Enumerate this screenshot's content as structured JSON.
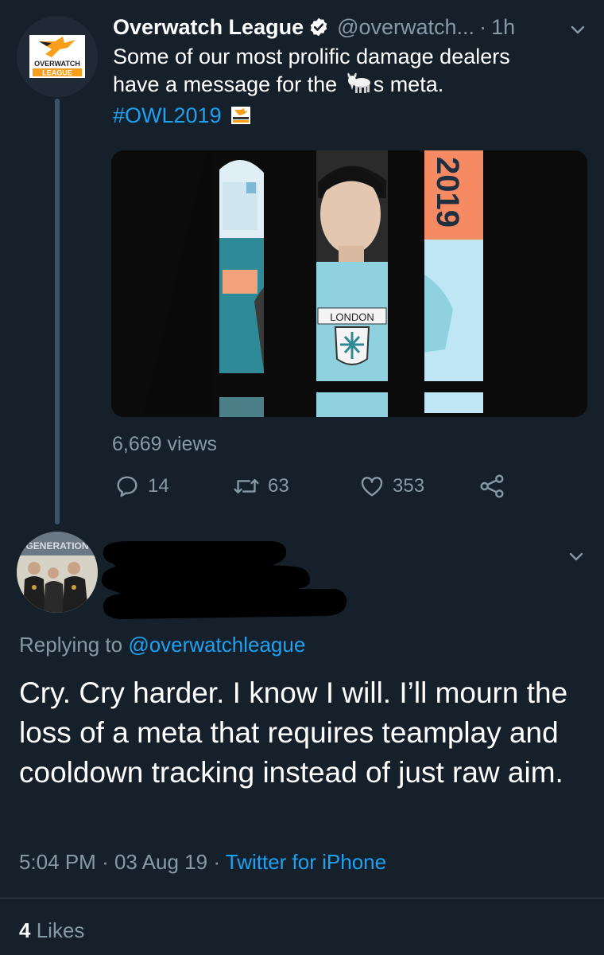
{
  "tweet": {
    "author_name": "Overwatch League",
    "handle": "@overwatch...",
    "separator": "·",
    "time": "1h",
    "text_line1": "Some of our most prolific damage dealers",
    "text_line2_pre": "have a message for the",
    "text_line2_post": "s meta.",
    "hashtag": "#OWL2019",
    "media": {
      "banner_text": "2019",
      "shirt_text": "LONDON"
    },
    "views": "6,669 views",
    "actions": {
      "reply_count": "14",
      "retweet_count": "63",
      "like_count": "353"
    },
    "logo": {
      "line1": "OVERWATCH",
      "line2": "LEAGUE"
    }
  },
  "reply": {
    "avatar_banner_text": "GENERATION",
    "replying_prefix": "Replying to",
    "replying_mention": "@overwatchleague",
    "text": "Cry. Cry harder. I know I will. I’ll mourn the loss of a meta that requires teamplay and cooldown tracking instead of just raw aim.",
    "time": "5:04 PM",
    "separator": "·",
    "date": "03 Aug 19",
    "source": "Twitter for iPhone",
    "likes_count": "4",
    "likes_label": "Likes"
  },
  "icons": {
    "verified": "verified-badge-icon",
    "chevron": "chevron-down-icon",
    "reply": "reply-icon",
    "retweet": "retweet-icon",
    "like": "heart-icon",
    "share": "share-icon",
    "goat": "goat-emoji-icon",
    "owl": "owl-hashflag-icon"
  },
  "colors": {
    "background": "#15202b",
    "text": "#ffffff",
    "secondary": "#8899a6",
    "link": "#1da1f2",
    "owl_orange": "#f99e1a"
  }
}
